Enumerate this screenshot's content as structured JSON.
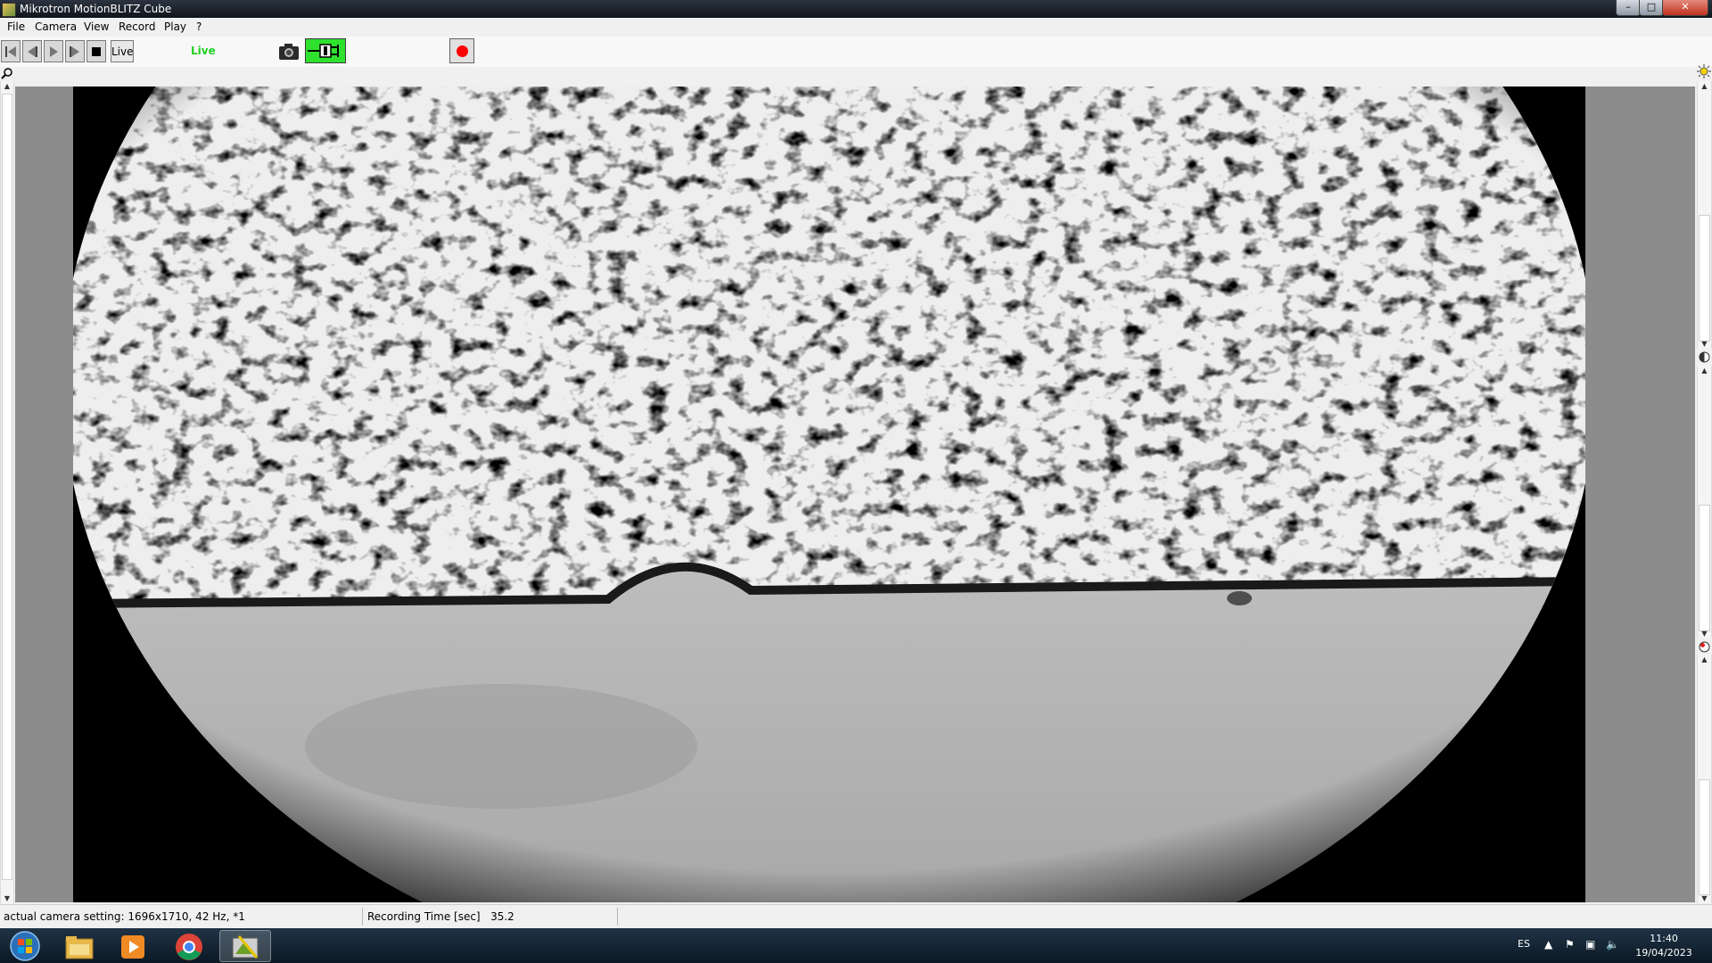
{
  "window": {
    "title": "Mikrotron MotionBLITZ Cube",
    "min_glyph": "–",
    "max_glyph": "□",
    "close_glyph": "✕"
  },
  "menu": {
    "items": [
      "File",
      "Camera",
      "View",
      "Record",
      "Play",
      "?"
    ]
  },
  "toolbar": {
    "live_button_label": "Live",
    "live_status": "Live",
    "live_status_color": "#22d022",
    "connect_color": "#2fe12f",
    "record_color": "#ff0000",
    "icons": [
      "skip-back-icon",
      "step-back-icon",
      "play-icon",
      "step-forward-icon",
      "stop-icon",
      "camera-icon",
      "connection-plug-icon",
      "record-icon"
    ]
  },
  "status_bar": {
    "camera_setting_label": "actual camera setting:",
    "camera_setting_value": "1696x1710, 42 Hz, *1",
    "recording_time_label": "Recording Time [sec]",
    "recording_time_value": "35.2"
  },
  "taskbar": {
    "pinned": [
      "start-orb-icon",
      "file-explorer-icon",
      "media-player-icon",
      "chrome-icon",
      "motionblitz-app-icon"
    ],
    "language": "ES",
    "time": "11:40",
    "date": "19/04/2023"
  }
}
